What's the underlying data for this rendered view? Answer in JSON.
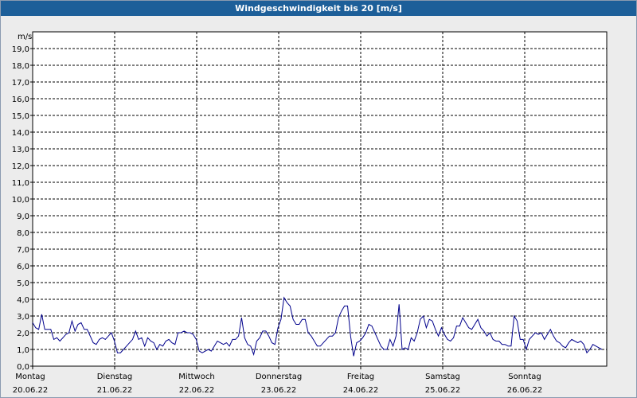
{
  "window": {
    "title": "Windgeschwindigkeit bis 20 [m/s]"
  },
  "chart_data": {
    "type": "line",
    "title": "Windgeschwindigkeit bis 20 [m/s]",
    "ylabel": "m/s",
    "ylim": [
      0,
      20
    ],
    "yticks": [
      "0,0",
      "1,0",
      "2,0",
      "3,0",
      "4,0",
      "5,0",
      "6,0",
      "7,0",
      "8,0",
      "9,0",
      "10,0",
      "11,0",
      "12,0",
      "13,0",
      "14,0",
      "15,0",
      "16,0",
      "17,0",
      "18,0",
      "19,0"
    ],
    "x_days": [
      {
        "day": "Montag",
        "date": "20.06.22"
      },
      {
        "day": "Dienstag",
        "date": "21.06.22"
      },
      {
        "day": "Mittwoch",
        "date": "22.06.22"
      },
      {
        "day": "Donnerstag",
        "date": "23.06.22"
      },
      {
        "day": "Freitag",
        "date": "24.06.22"
      },
      {
        "day": "Samstag",
        "date": "25.06.22"
      },
      {
        "day": "Sonntag",
        "date": "26.06.22"
      }
    ],
    "grid": true,
    "line_color": "#00008b",
    "series": [
      {
        "values": [
          2.6,
          2.3,
          2.2,
          3.1,
          2.2,
          2.2,
          2.2,
          1.6,
          1.7,
          1.5,
          1.7,
          1.9,
          2.0,
          2.7,
          2.1,
          2.5,
          2.6,
          2.2,
          2.2,
          1.8,
          1.4,
          1.3,
          1.6,
          1.7,
          1.6,
          1.8,
          2.0,
          1.5,
          0.8,
          0.8,
          1.0,
          1.2,
          1.4,
          1.6,
          2.1,
          1.6,
          1.7,
          1.2,
          1.7,
          1.5,
          1.4,
          1.0,
          1.3,
          1.2,
          1.5,
          1.6,
          1.4,
          1.3,
          2.0,
          2.0,
          2.1,
          2.0,
          2.0,
          1.9,
          1.6,
          0.9,
          0.8,
          0.9,
          1.0,
          0.9,
          1.2,
          1.5,
          1.4,
          1.3,
          1.4,
          1.2,
          1.6,
          1.6,
          1.8,
          2.9,
          1.7,
          1.3,
          1.2,
          0.7,
          1.5,
          1.7,
          2.1,
          2.1,
          1.8,
          1.4,
          1.3,
          2.3,
          2.8,
          4.1,
          3.8,
          3.6,
          2.8,
          2.5,
          2.5,
          2.8,
          2.8,
          2.0,
          1.8,
          1.5,
          1.2,
          1.2,
          1.4,
          1.6,
          1.8,
          1.8,
          2.0,
          2.9,
          3.3,
          3.6,
          3.6,
          1.8,
          0.6,
          1.4,
          1.5,
          1.7,
          2.0,
          2.5,
          2.4,
          2.0,
          1.6,
          1.2,
          1.0,
          1.0,
          1.6,
          1.2,
          1.8,
          3.7,
          1.0,
          1.1,
          1.0,
          1.7,
          1.5,
          2.0,
          2.8,
          3.0,
          2.3,
          2.8,
          2.7,
          2.2,
          1.8,
          2.3,
          1.9,
          1.6,
          1.5,
          1.7,
          2.4,
          2.4,
          2.9,
          2.6,
          2.3,
          2.2,
          2.5,
          2.8,
          2.3,
          2.1,
          1.8,
          2.0,
          1.6,
          1.5,
          1.5,
          1.3,
          1.3,
          1.2,
          1.2,
          3.0,
          2.7,
          1.6,
          1.6,
          1.0,
          1.6,
          1.8,
          2.0,
          1.9,
          2.0,
          1.6,
          1.9,
          2.2,
          1.8,
          1.5,
          1.4,
          1.2,
          1.1,
          1.4,
          1.6,
          1.5,
          1.4,
          1.5,
          1.3,
          0.8,
          1.0,
          1.3,
          1.2,
          1.1,
          1.0
        ]
      }
    ]
  }
}
